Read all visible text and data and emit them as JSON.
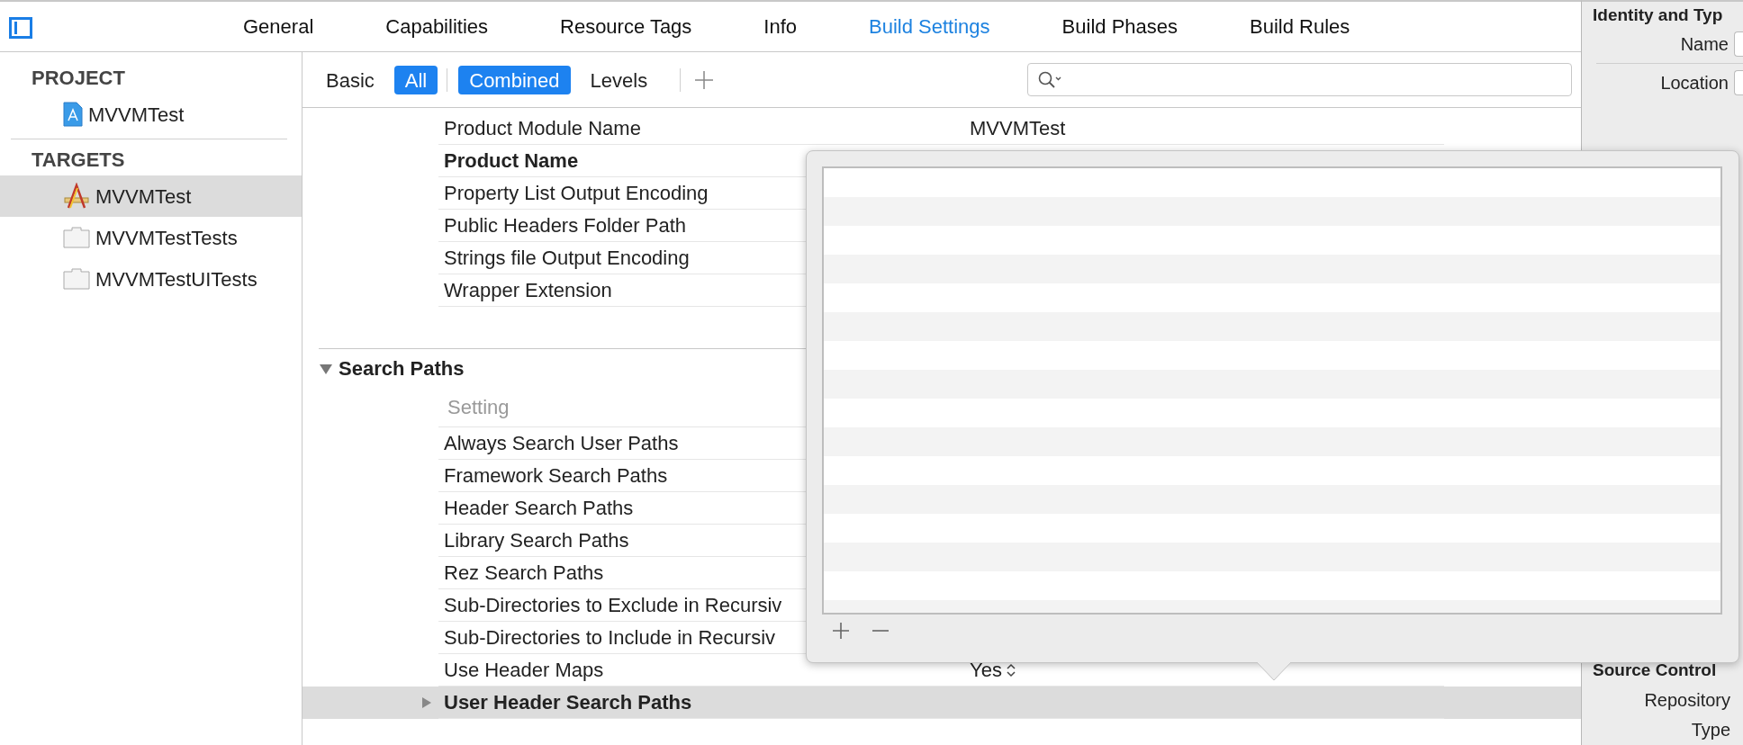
{
  "tabs": [
    {
      "label": "General",
      "selected": false
    },
    {
      "label": "Capabilities",
      "selected": false
    },
    {
      "label": "Resource Tags",
      "selected": false
    },
    {
      "label": "Info",
      "selected": false
    },
    {
      "label": "Build Settings",
      "selected": true
    },
    {
      "label": "Build Phases",
      "selected": false
    },
    {
      "label": "Build Rules",
      "selected": false
    }
  ],
  "navigator": {
    "sections": [
      {
        "title": "PROJECT",
        "items": [
          {
            "label": "MVVMTest",
            "kind": "project",
            "selected": false
          }
        ]
      },
      {
        "title": "TARGETS",
        "items": [
          {
            "label": "MVVMTest",
            "kind": "app",
            "selected": true
          },
          {
            "label": "MVVMTestTests",
            "kind": "bundle",
            "selected": false
          },
          {
            "label": "MVVMTestUITests",
            "kind": "bundle",
            "selected": false
          }
        ]
      }
    ]
  },
  "filter_bar": {
    "scope": [
      {
        "label": "Basic",
        "selected": false
      },
      {
        "label": "All",
        "selected": true
      }
    ],
    "view": [
      {
        "label": "Combined",
        "selected": true
      },
      {
        "label": "Levels",
        "selected": false
      }
    ]
  },
  "settings": {
    "rows": [
      {
        "label": "Product Module Name",
        "value": "MVVMTest",
        "bold": false
      },
      {
        "label": "Product Name",
        "bold": true
      },
      {
        "label": "Property List Output Encoding",
        "bold": false
      },
      {
        "label": "Public Headers Folder Path",
        "bold": false
      },
      {
        "label": "Strings file Output Encoding",
        "bold": false
      },
      {
        "label": "Wrapper Extension",
        "bold": false
      }
    ],
    "sections": [
      {
        "title": "Search Paths",
        "expanded": true,
        "column_header": "Setting",
        "rows": [
          {
            "label": "Always Search User Paths",
            "bold": false,
            "selected": false
          },
          {
            "label": "Framework Search Paths",
            "bold": false,
            "selected": false
          },
          {
            "label": "Header Search Paths",
            "bold": false,
            "selected": false
          },
          {
            "label": "Library Search Paths",
            "bold": false,
            "selected": false
          },
          {
            "label": "Rez Search Paths",
            "bold": false,
            "selected": false
          },
          {
            "label": "Sub-Directories to Exclude in Recursiv",
            "bold": false,
            "selected": false
          },
          {
            "label": "Sub-Directories to Include in Recursiv",
            "bold": false,
            "selected": false
          },
          {
            "label": "Use Header Maps",
            "value": "Yes",
            "kind": "popup",
            "bold": false,
            "selected": false
          },
          {
            "label": "User Header Search Paths",
            "kind": "group",
            "expanded": false,
            "bold": true,
            "selected": true
          }
        ]
      }
    ]
  },
  "inspector": {
    "sections": [
      {
        "title": "Identity and Typ",
        "fields": [
          {
            "label": "Name"
          },
          {
            "label": "Location"
          }
        ]
      },
      {
        "title": "Source Control",
        "fields": [
          {
            "label": "Repository"
          },
          {
            "label": "Type"
          }
        ]
      }
    ]
  }
}
